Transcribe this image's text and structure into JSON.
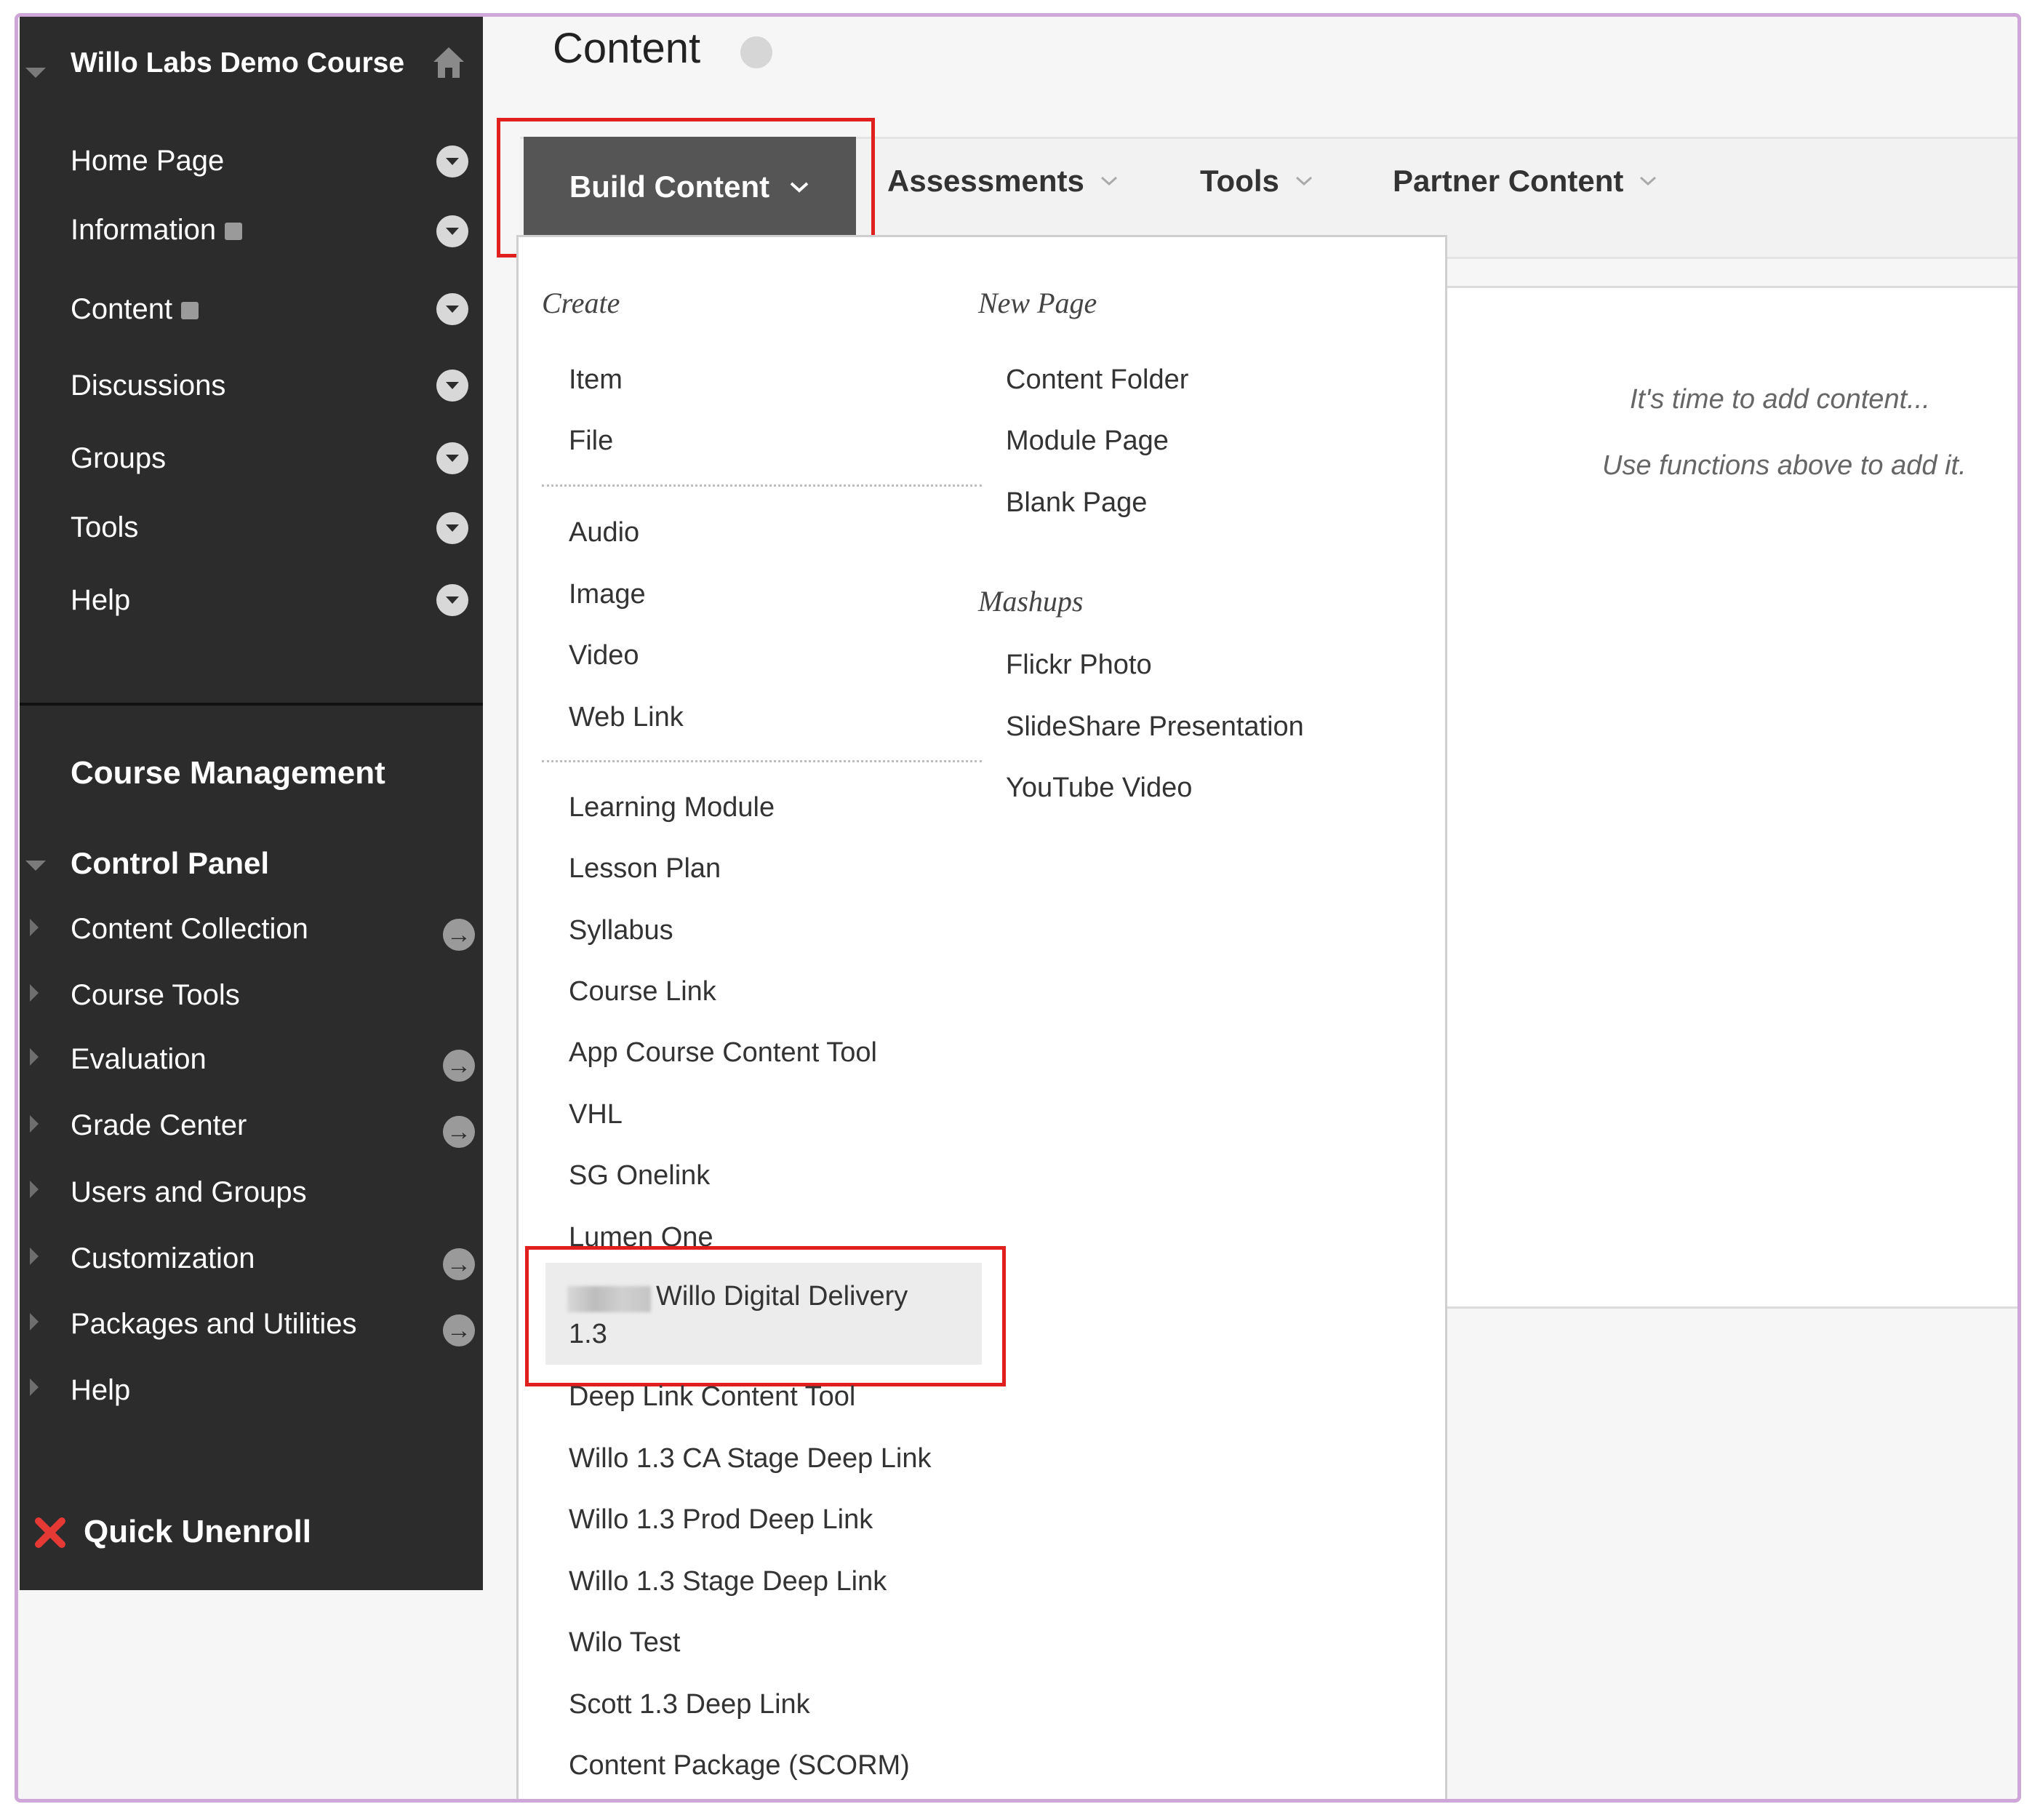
{
  "sidebar": {
    "course_title": "Willo Labs Demo Course",
    "menu_items": [
      {
        "label": "Home Page"
      },
      {
        "label": "Information"
      },
      {
        "label": "Content"
      },
      {
        "label": "Discussions"
      },
      {
        "label": "Groups"
      },
      {
        "label": "Tools"
      },
      {
        "label": "Help"
      }
    ],
    "course_management_label": "Course Management",
    "control_panel_label": "Control Panel",
    "control_panel_items": [
      {
        "label": "Content Collection"
      },
      {
        "label": "Course Tools"
      },
      {
        "label": "Evaluation"
      },
      {
        "label": "Grade Center"
      },
      {
        "label": "Users and Groups"
      },
      {
        "label": "Customization"
      },
      {
        "label": "Packages and Utilities"
      },
      {
        "label": "Help"
      }
    ],
    "quick_unenroll_label": "Quick Unenroll"
  },
  "page": {
    "title": "Content"
  },
  "tabs": {
    "build_content": "Build Content",
    "assessments": "Assessments",
    "tools": "Tools",
    "partner_content": "Partner Content"
  },
  "dropdown": {
    "create_heading": "Create",
    "create_group1": [
      "Item",
      "File"
    ],
    "create_group2": [
      "Audio",
      "Image",
      "Video",
      "Web Link"
    ],
    "create_group3": [
      "Learning Module",
      "Lesson Plan",
      "Syllabus",
      "Course Link",
      "App Course Content Tool",
      "VHL",
      "SG Onelink",
      "Lumen One"
    ],
    "highlighted_item_line1": "Willo Digital Delivery",
    "highlighted_item_line2": "1.3",
    "create_group4": [
      "Deep Link Content Tool",
      "Willo 1.3 CA Stage Deep Link",
      "Willo 1.3 Prod Deep Link",
      "Willo 1.3 Stage Deep Link",
      "Wilo Test",
      "Scott 1.3 Deep Link",
      "Content Package (SCORM)"
    ],
    "new_page_heading": "New Page",
    "new_page_items": [
      "Content Folder",
      "Module Page",
      "Blank Page"
    ],
    "mashups_heading": "Mashups",
    "mashups_items": [
      "Flickr Photo",
      "SlideShare Presentation",
      "YouTube Video"
    ]
  },
  "empty_state": {
    "line1": "It's time to add content...",
    "line2": "Use functions above to add it."
  },
  "colors": {
    "sidebar_bg": "#2c2c2c",
    "build_button_bg": "#555555",
    "highlight_border": "#e0201f",
    "frame_border": "#cfa6d8"
  }
}
